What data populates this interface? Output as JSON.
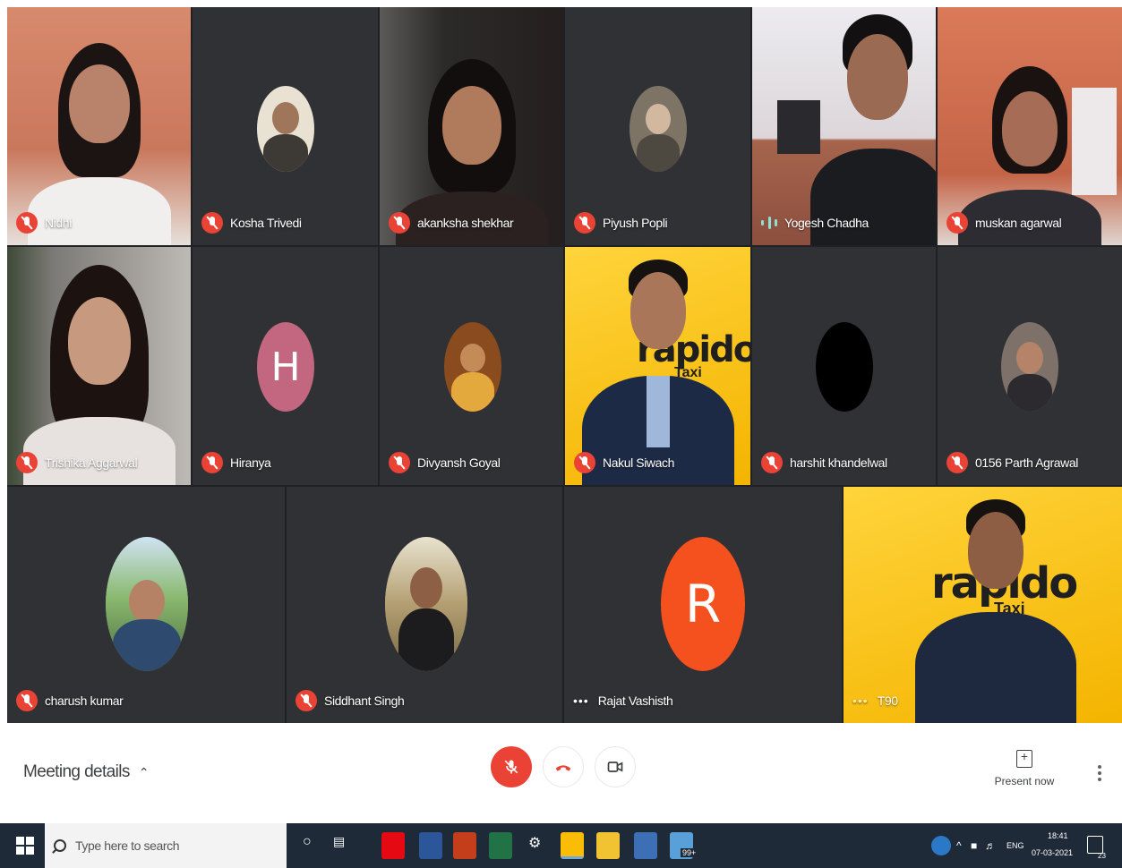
{
  "participants_row1": [
    {
      "name": "Nidhi",
      "status": "muted"
    },
    {
      "name": "Kosha Trivedi",
      "status": "muted"
    },
    {
      "name": "akanksha shekhar",
      "status": "muted"
    },
    {
      "name": "Piyush Popli",
      "status": "muted"
    },
    {
      "name": "Yogesh Chadha",
      "status": "speaking"
    },
    {
      "name": "muskan agarwal",
      "status": "muted"
    }
  ],
  "participants_row2": [
    {
      "name": "Trishika Aggarwal",
      "status": "muted"
    },
    {
      "name": "Hiranya",
      "status": "muted",
      "avatar_letter": "H"
    },
    {
      "name": "Divyansh Goyal",
      "status": "muted"
    },
    {
      "name": "Nakul Siwach",
      "status": "muted"
    },
    {
      "name": "harshit khandelwal",
      "status": "muted"
    },
    {
      "name": "0156 Parth Agrawal",
      "status": "muted"
    }
  ],
  "participants_row3": [
    {
      "name": "charush kumar",
      "status": "muted"
    },
    {
      "name": "Siddhant Singh",
      "status": "muted"
    },
    {
      "name": "Rajat Vashisth",
      "status": "more",
      "avatar_letter": "R"
    },
    {
      "name": "T90",
      "status": "active"
    }
  ],
  "video_overlay_text": {
    "brand1": "rapido",
    "brand1_sub": "Taxi",
    "brand2": "rapido",
    "brand2_sub": "Taxi"
  },
  "controls": {
    "meeting_details_label": "Meeting details",
    "present_label": "Present now"
  },
  "taskbar": {
    "search_placeholder": "Type here to search",
    "language": "ENG",
    "time": "18:41",
    "date": "07-03-2021",
    "notification_count": "23",
    "calendar_badge": "99+"
  },
  "colors": {
    "accent_red": "#ea4335",
    "speaking_teal": "#8ee0d6",
    "tile_dark": "#202124",
    "avatar_h": "#c2677f",
    "avatar_r": "#f4511e",
    "video_yellow": "#f4b400",
    "taskbar": "#1f2a38"
  },
  "icons": [
    "mic-off-icon",
    "hang-up-icon",
    "camera-icon",
    "present-icon",
    "more-vert-icon",
    "windows-icon",
    "search-icon",
    "chevron-up-icon"
  ]
}
